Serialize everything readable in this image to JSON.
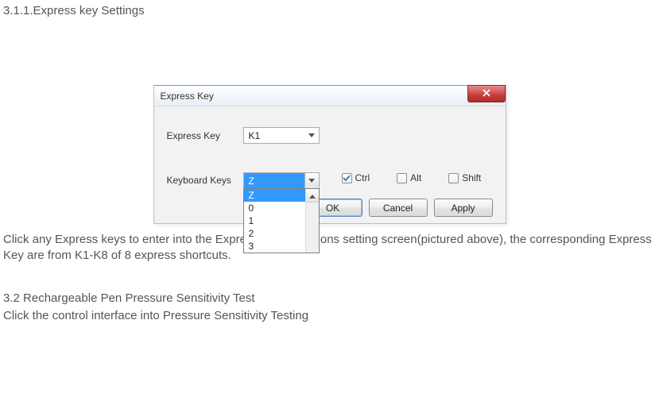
{
  "doc": {
    "heading_1": "3.1.1.Express key Settings",
    "paragraph_1": "Click any Express keys to enter into the Express  keys' functions setting screen(pictured above), the corresponding Express Key are from K1-K8 of 8 express shortcuts.",
    "heading_2": "3.2  Rechargeable Pen Pressure Sensitivity Test",
    "paragraph_2": "Click  the control interface  into Pressure Sensitivity Testing"
  },
  "dialog": {
    "title": "Express Key",
    "fields": {
      "express_key": {
        "label": "Express Key",
        "value": "K1"
      },
      "keyboard_keys": {
        "label": "Keyboard Keys",
        "value": "Z",
        "dropdown": {
          "options": [
            "Z",
            "0",
            "1",
            "2",
            "3"
          ],
          "selected_index": 0
        }
      }
    },
    "modifiers": {
      "ctrl": {
        "label": "Ctrl",
        "checked": true
      },
      "alt": {
        "label": "Alt",
        "checked": false
      },
      "shift": {
        "label": "Shift",
        "checked": false
      }
    },
    "buttons": {
      "ok": "OK",
      "cancel": "Cancel",
      "apply": "Apply"
    }
  }
}
